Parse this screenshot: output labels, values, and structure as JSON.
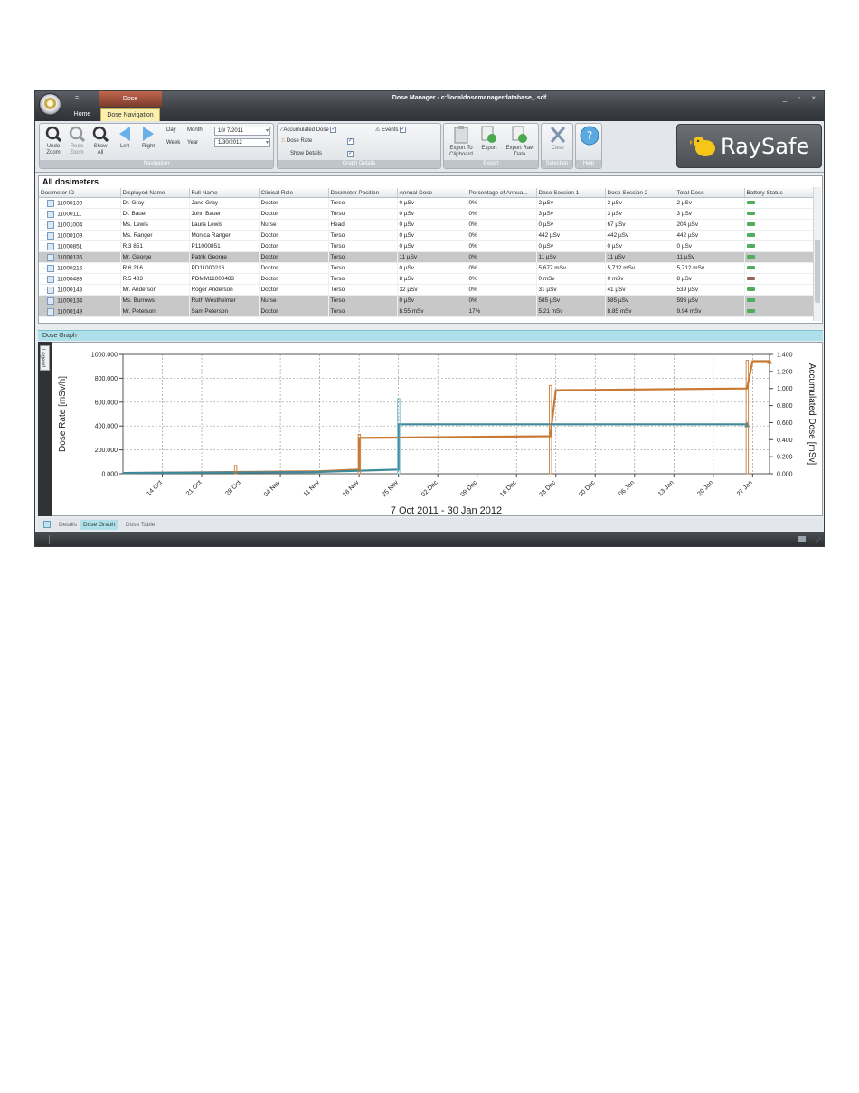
{
  "window": {
    "title": "Dose Manager - c:\\localdosemanagerdatabase_.sdf",
    "context_tab": "Dose",
    "qat_symbol": "=",
    "controls": "_ ▫ ×",
    "tabs": [
      "Home",
      "Dose Navigation"
    ]
  },
  "ribbon": {
    "navigation": {
      "label": "Navigation",
      "undo_zoom": "Undo\nZoom",
      "redo_zoom": "Redo\nZoom",
      "show_all": "Show\nAll",
      "left": "Left",
      "right": "Right",
      "day": "Day",
      "week": "Week",
      "month": "Month",
      "year": "Year",
      "date_from": "10/ 7/2011",
      "date_to": "1/30/2012"
    },
    "graph_details": {
      "label": "Graph Details",
      "accumulated_dose": "Accumulated Dose",
      "dose_rate": "Dose Rate",
      "show_details": "Show Details",
      "events": "Events"
    },
    "export": {
      "label": "Export",
      "export_clipboard": "Export To\nClipboard",
      "export": "Export",
      "export_raw": "Export Raw\nData"
    },
    "selection": {
      "label": "Selection",
      "clear": "Clear"
    },
    "help": {
      "label": "Help"
    },
    "logo": "RaySafe"
  },
  "grid": {
    "title": "All dosimeters",
    "columns": [
      "Dosimeter ID",
      "Displayed Name",
      "Full Name",
      "Clinical Role",
      "Dosimeter Position",
      "Annual Dose",
      "Percentage of Annua...",
      "Dose Session 1",
      "Dose Session 2",
      "Total Dose",
      "Battery Status"
    ],
    "rows": [
      {
        "id": "11000139",
        "displayed": "Dr. Gray",
        "full": "Jane Gray",
        "role": "Doctor",
        "pos": "Torso",
        "annual": "0 µSv",
        "pct": "0%",
        "s1": "2 µSv",
        "s2": "2 µSv",
        "total": "2 µSv",
        "batt": "ok",
        "sel": false
      },
      {
        "id": "11000111",
        "displayed": "Dr. Bauer",
        "full": "John Bauer",
        "role": "Doctor",
        "pos": "Torso",
        "annual": "0 µSv",
        "pct": "0%",
        "s1": "3 µSv",
        "s2": "3 µSv",
        "total": "3 µSv",
        "batt": "ok",
        "sel": false
      },
      {
        "id": "11001004",
        "displayed": "Ms. Lewis",
        "full": "Laura Lewis",
        "role": "Nurse",
        "pos": "Head",
        "annual": "0 µSv",
        "pct": "0%",
        "s1": "0 µSv",
        "s2": "67 µSv",
        "total": "204 µSv",
        "batt": "ok",
        "sel": false
      },
      {
        "id": "11000109",
        "displayed": "Ms. Ranger",
        "full": "Monica Ranger",
        "role": "Doctor",
        "pos": "Torso",
        "annual": "0 µSv",
        "pct": "0%",
        "s1": "442 µSv",
        "s2": "442 µSv",
        "total": "442 µSv",
        "batt": "ok",
        "sel": false
      },
      {
        "id": "11000851",
        "displayed": "R.3   851",
        "full": "P11000851",
        "role": "Doctor",
        "pos": "Torso",
        "annual": "0 µSv",
        "pct": "0%",
        "s1": "0 µSv",
        "s2": "0 µSv",
        "total": "0 µSv",
        "batt": "ok",
        "sel": false
      },
      {
        "id": "11000136",
        "displayed": "Mr. George",
        "full": "Patrik George",
        "role": "Doctor",
        "pos": "Torso",
        "annual": "11 µSv",
        "pct": "0%",
        "s1": "11 µSv",
        "s2": "11 µSv",
        "total": "11 µSv",
        "batt": "ok",
        "sel": true
      },
      {
        "id": "11000216",
        "displayed": "R.6   216",
        "full": "PD11000216",
        "role": "Doctor",
        "pos": "Torso",
        "annual": "0 µSv",
        "pct": "0%",
        "s1": "5,677 mSv",
        "s2": "5,712 mSv",
        "total": "5,712 mSv",
        "batt": "ok",
        "sel": false
      },
      {
        "id": "11000483",
        "displayed": "R.5   483",
        "full": "PDMM11000483",
        "role": "Doctor",
        "pos": "Torso",
        "annual": "8 µSv",
        "pct": "0%",
        "s1": "0 mSv",
        "s2": "0 mSv",
        "total": "8 µSv",
        "batt": "low",
        "sel": false
      },
      {
        "id": "11000143",
        "displayed": "Mr. Anderson",
        "full": "Roger Anderson",
        "role": "Doctor",
        "pos": "Torso",
        "annual": "32 µSv",
        "pct": "0%",
        "s1": "31 µSv",
        "s2": "41 µSv",
        "total": "539 µSv",
        "batt": "ok",
        "sel": false
      },
      {
        "id": "11000134",
        "displayed": "Ms. Burrows",
        "full": "Ruth Westheimer",
        "role": "Nurse",
        "pos": "Torso",
        "annual": "0 µSv",
        "pct": "0%",
        "s1": "585 µSv",
        "s2": "585 µSv",
        "total": "596 µSv",
        "batt": "ok",
        "sel": true
      },
      {
        "id": "11000149",
        "displayed": "Mr. Peterson",
        "full": "Sam Peterson",
        "role": "Doctor",
        "pos": "Torso",
        "annual": "8.55 mSv",
        "pct": "17%",
        "s1": "5.21 mSv",
        "s2": "8.85 mSv",
        "total": "9.94 mSv",
        "batt": "ok",
        "sel": true
      }
    ]
  },
  "dose_graph": {
    "title": "Dose Graph",
    "legend_label": "Legend"
  },
  "bottom_tabs": [
    "Details",
    "Dose Graph",
    "Dose Table"
  ],
  "colors": {
    "orange": "#c87a35",
    "teal": "#3e8a99",
    "accent": "#aee0ea"
  },
  "chart_data": {
    "type": "line",
    "xlabel": "7 Oct 2011 - 30 Jan 2012",
    "ylabel": "Dose Rate [mSv/h]",
    "y2label": "Accumulated Dose [mSv]",
    "ylim": [
      0,
      1000
    ],
    "y2lim": [
      0,
      1.4
    ],
    "y_ticks": [
      "0.000",
      "200.000",
      "400.000",
      "600.000",
      "800.000",
      "1000.000"
    ],
    "y2_ticks": [
      "0.000",
      "0.200",
      "0.400",
      "0.600",
      "0.800",
      "1.000",
      "1.200",
      "1.400"
    ],
    "x_ticks": [
      "14 Oct",
      "21 Oct",
      "28 Oct",
      "04 Nov",
      "11 Nov",
      "18 Nov",
      "25 Nov",
      "02 Dec",
      "09 Dec",
      "16 Dec",
      "23 Dec",
      "30 Dec",
      "06 Jan",
      "13 Jan",
      "20 Jan",
      "27 Jan"
    ],
    "x_range": [
      "2011-10-07",
      "2012-01-30"
    ],
    "grid": true,
    "series": [
      {
        "axis": "y2",
        "color": "#c87a35",
        "x": [
          "2011-10-07",
          "2011-11-11",
          "2011-11-18",
          "2011-11-18",
          "2011-12-22",
          "2011-12-23",
          "2012-01-26",
          "2012-01-27",
          "2012-01-30"
        ],
        "values": [
          0.01,
          0.03,
          0.05,
          0.42,
          0.44,
          0.98,
          1.0,
          1.32,
          1.32
        ]
      },
      {
        "axis": "y2",
        "color": "#3e8a99",
        "x": [
          "2011-10-07",
          "2011-11-10",
          "2011-11-25",
          "2011-11-25",
          "2012-01-26"
        ],
        "values": [
          0.01,
          0.02,
          0.05,
          0.58,
          0.58
        ]
      },
      {
        "axis": "y",
        "color": "#c87a35",
        "kind": "spike",
        "x": [
          "2011-10-27",
          "2011-11-18",
          "2011-12-22",
          "2012-01-26"
        ],
        "values": [
          70,
          330,
          740,
          950
        ]
      },
      {
        "axis": "y",
        "color": "#6fb7c8",
        "kind": "spike",
        "x": [
          "2011-11-25"
        ],
        "values": [
          630
        ]
      }
    ]
  }
}
